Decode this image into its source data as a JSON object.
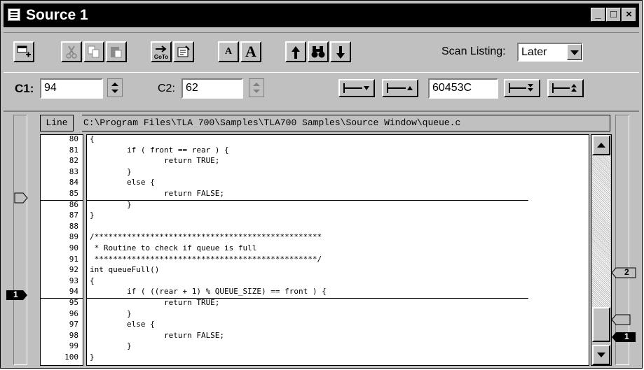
{
  "window": {
    "title": "Source 1",
    "minimize": "_",
    "maximize": "□",
    "close": "×"
  },
  "toolbar": {
    "scan_label": "Scan Listing:",
    "scan_value": "Later",
    "font_small": "A",
    "font_large": "A",
    "goto_label": "GoTo"
  },
  "cursors": {
    "c1_label": "C1:",
    "c1_value": "94",
    "c2_label": "C2:",
    "c2_value": "62",
    "address_value": "60453C"
  },
  "listing": {
    "line_header": "Line",
    "file_path": "C:\\Program Files\\TLA 700\\Samples\\TLA700 Samples\\Source Window\\queue.c",
    "line_numbers": [
      "80",
      "81",
      "82",
      "83",
      "84",
      "85",
      "86",
      "87",
      "88",
      "89",
      "90",
      "91",
      "92",
      "93",
      "94",
      "95",
      "96",
      "97",
      "98",
      "99",
      "100"
    ],
    "lines": [
      "{",
      "        if ( front == rear ) {",
      "                return TRUE;",
      "        }",
      "        else {",
      "                return FALSE;",
      "        }",
      "}",
      "",
      "/*************************************************",
      " * Routine to check if queue is full",
      " ************************************************/",
      "int queueFull()",
      "{",
      "        if ( ((rear + 1) % QUEUE_SIZE) == front ) {",
      "                return TRUE;",
      "        }",
      "        else {",
      "                return FALSE;",
      "        }",
      "}"
    ]
  },
  "markers": {
    "left_cursor": "1",
    "right_top": "2",
    "right_bottom": "1"
  }
}
